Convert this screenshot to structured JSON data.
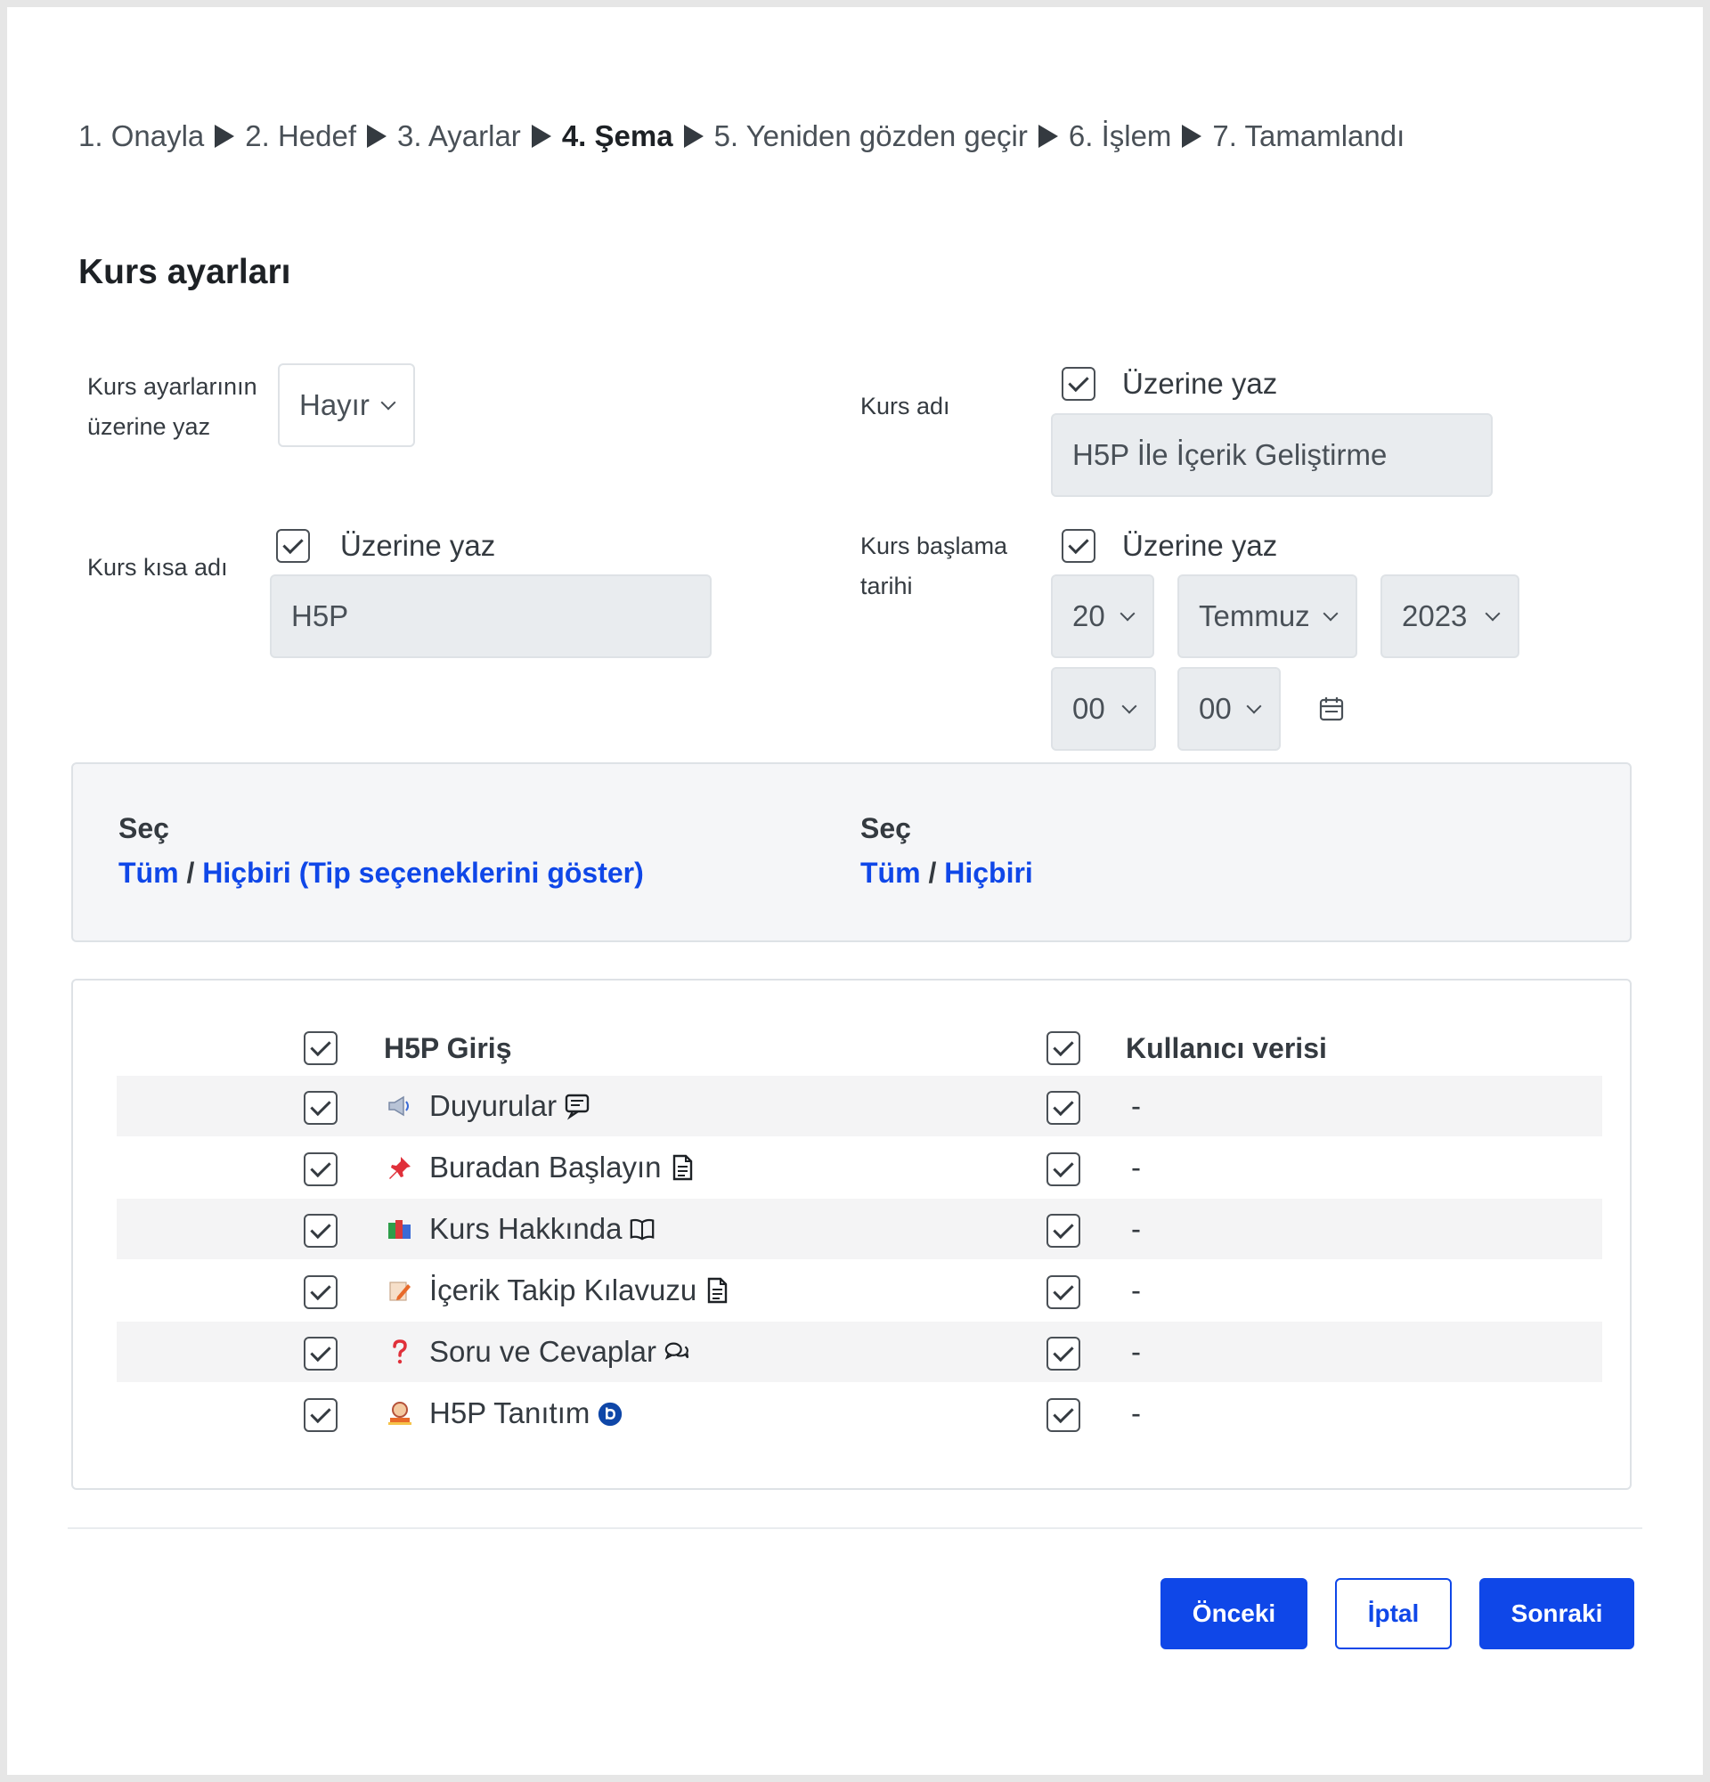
{
  "breadcrumb": {
    "steps": [
      "1. Onayla",
      "2. Hedef",
      "3. Ayarlar",
      "4. Şema",
      "5. Yeniden gözden geçir",
      "6. İşlem",
      "7. Tamamlandı"
    ],
    "current_index": 3
  },
  "section_title": "Kurs ayarları",
  "form": {
    "overwrite_settings": {
      "label_line1": "Kurs ayarlarının",
      "label_line2": "üzerine yaz",
      "value": "Hayır"
    },
    "course_name": {
      "label": "Kurs adı",
      "overwrite_label": "Üzerine yaz",
      "overwrite_checked": true,
      "value": "H5P İle İçerik Geliştirme"
    },
    "short_name": {
      "label": "Kurs kısa adı",
      "overwrite_label": "Üzerine yaz",
      "overwrite_checked": true,
      "value": "H5P"
    },
    "start_date": {
      "label_line1": "Kurs başlama",
      "label_line2": "tarihi",
      "overwrite_label": "Üzerine yaz",
      "overwrite_checked": true,
      "day": "20",
      "month": "Temmuz",
      "year": "2023",
      "hour": "00",
      "minute": "00"
    }
  },
  "select_panel": {
    "left": {
      "title": "Seç",
      "all": "Tüm",
      "slash": "/",
      "none": "Hiçbiri",
      "types_open": "(",
      "types": "Tip seçeneklerini göster",
      "types_close": ")"
    },
    "right": {
      "title": "Seç",
      "all": "Tüm",
      "slash": "/",
      "none": "Hiçbiri"
    }
  },
  "sections": {
    "header": {
      "title": "H5P Giriş",
      "user_data_label": "Kullanıcı verisi",
      "checked": true,
      "user_data_checked": true
    },
    "rows": [
      {
        "label": "Duyurular",
        "icon": "megaphone-icon",
        "type_icon": "forum-icon",
        "user_data": "-"
      },
      {
        "label": "Buradan Başlayın",
        "icon": "pin-icon",
        "type_icon": "page-icon",
        "user_data": "-"
      },
      {
        "label": "Kurs Hakkında",
        "icon": "books-icon",
        "type_icon": "book-icon",
        "user_data": "-"
      },
      {
        "label": "İçerik Takip Kılavuzu",
        "icon": "note-pencil-icon",
        "type_icon": "page-icon",
        "user_data": "-"
      },
      {
        "label": "Soru ve Cevaplar",
        "icon": "question-icon",
        "type_icon": "chat-icon",
        "user_data": "-"
      },
      {
        "label": "H5P Tanıtım",
        "icon": "presenter-icon",
        "type_icon": "bigbluebutton-icon",
        "user_data": "-"
      }
    ]
  },
  "buttons": {
    "previous": "Önceki",
    "cancel": "İptal",
    "next": "Sonraki"
  },
  "colors": {
    "primary": "#0f47e8",
    "text": "#343a40",
    "row_band": "#f4f4f5"
  }
}
